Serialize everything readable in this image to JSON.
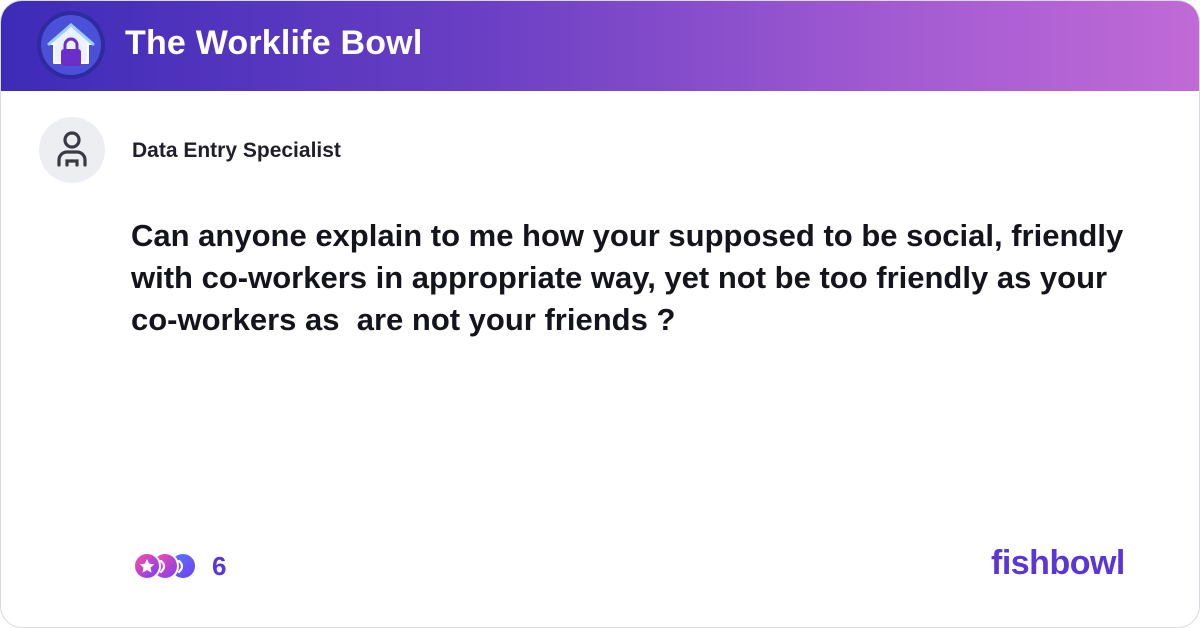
{
  "header": {
    "bowl_name": "The Worklife Bowl",
    "icon": "house-lock-icon",
    "gradient": [
      "#3d2bb8",
      "#c06ad6"
    ]
  },
  "post": {
    "author_title": "Data Entry Specialist",
    "avatar_icon": "user-icon",
    "question": "Can anyone explain to me how your supposed to be social, friendly with co-workers in appropriate way, yet not be too friendly as your co-workers as  are not your friends ?"
  },
  "footer": {
    "reactions_icon": "reaction-stack-icon",
    "reaction_count": "6",
    "brand": "fishbowl",
    "brand_color": "#5b36d6"
  }
}
